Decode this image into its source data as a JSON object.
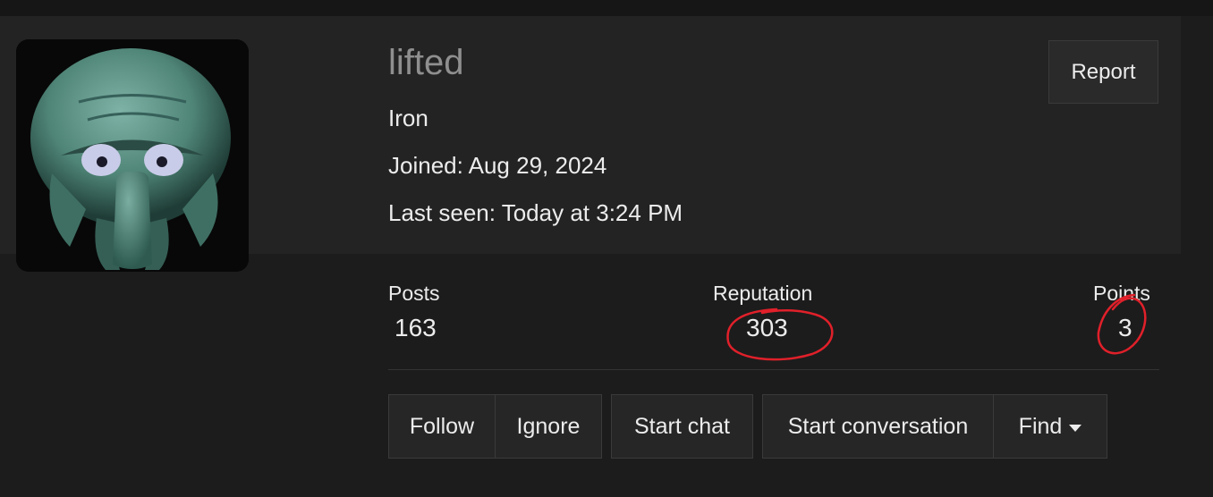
{
  "profile": {
    "username": "lifted",
    "role": "Iron",
    "joined": "Joined: Aug 29, 2024",
    "last_seen": "Last seen: Today at 3:24 PM"
  },
  "header": {
    "report_label": "Report"
  },
  "stats": {
    "posts_label": "Posts",
    "posts_value": "163",
    "reputation_label": "Reputation",
    "reputation_value": "303",
    "points_label": "Points",
    "points_value": "3"
  },
  "actions": {
    "follow": "Follow",
    "ignore": "Ignore",
    "start_chat": "Start chat",
    "start_conversation": "Start conversation",
    "find": "Find"
  },
  "colors": {
    "background": "#1c1c1c",
    "panel": "#232323",
    "button": "#262626",
    "annotation": "#e0202a"
  }
}
